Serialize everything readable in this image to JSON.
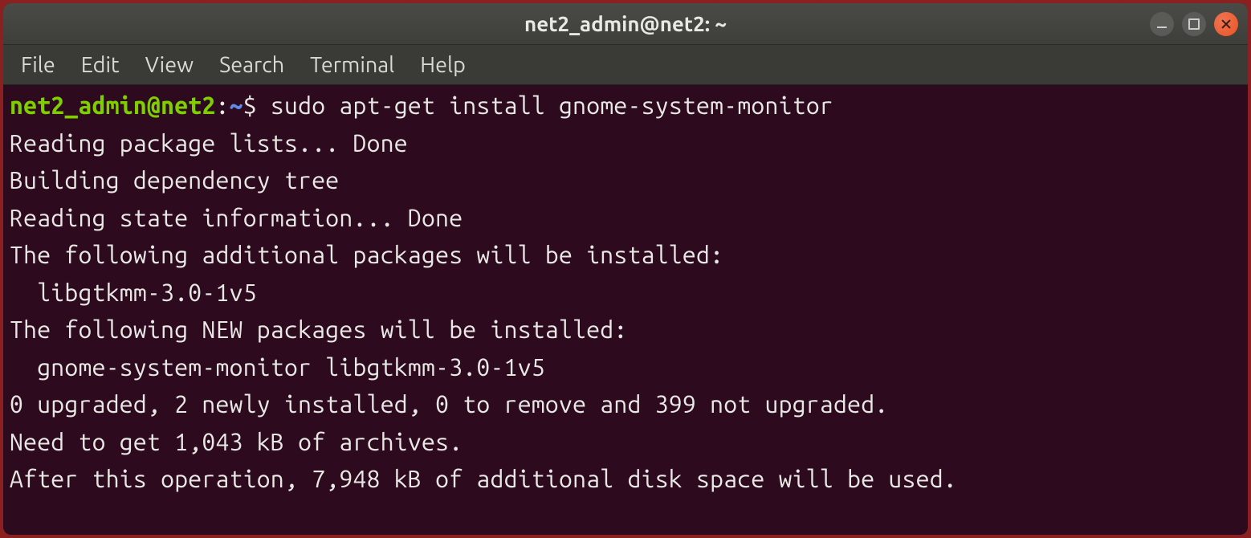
{
  "titlebar": {
    "title": "net2_admin@net2: ~"
  },
  "menubar": {
    "items": [
      "File",
      "Edit",
      "View",
      "Search",
      "Terminal",
      "Help"
    ]
  },
  "prompt": {
    "user_host": "net2_admin@net2",
    "colon": ":",
    "cwd": "~",
    "symbol": "$ ",
    "command": "sudo apt-get install gnome-system-monitor"
  },
  "output": {
    "lines": [
      "Reading package lists... Done",
      "Building dependency tree",
      "Reading state information... Done",
      "The following additional packages will be installed:",
      "  libgtkmm-3.0-1v5",
      "The following NEW packages will be installed:",
      "  gnome-system-monitor libgtkmm-3.0-1v5",
      "0 upgraded, 2 newly installed, 0 to remove and 399 not upgraded.",
      "Need to get 1,043 kB of archives.",
      "After this operation, 7,948 kB of additional disk space will be used."
    ]
  }
}
